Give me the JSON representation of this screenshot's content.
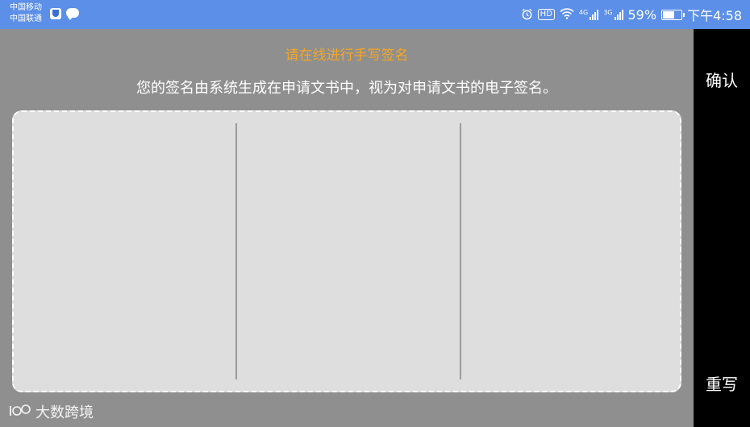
{
  "status_bar": {
    "carrier_1": "中国移动",
    "carrier_2": "中国联通",
    "signal_1_tag": "4G",
    "signal_2_tag": "3G",
    "battery_percent": "59%",
    "battery_level": 0.59,
    "time": "下午4:58",
    "hd_label": "HD",
    "icons": [
      "shield-app-icon",
      "chat-bubble-icon",
      "alarm-icon",
      "hd-icon",
      "wifi-icon",
      "signal-icon",
      "battery-icon"
    ],
    "bg_color": "#5b8fe8"
  },
  "main": {
    "title": "请在线进行手写签名",
    "subtitle": "您的签名由系统生成在申请文书中，视为对申请文书的电子签名。",
    "title_color": "#f5a623",
    "pad_color": "#dedede"
  },
  "actions": {
    "confirm_label": "确认",
    "rewrite_label": "重写"
  },
  "watermark": {
    "text": "大数跨境"
  }
}
